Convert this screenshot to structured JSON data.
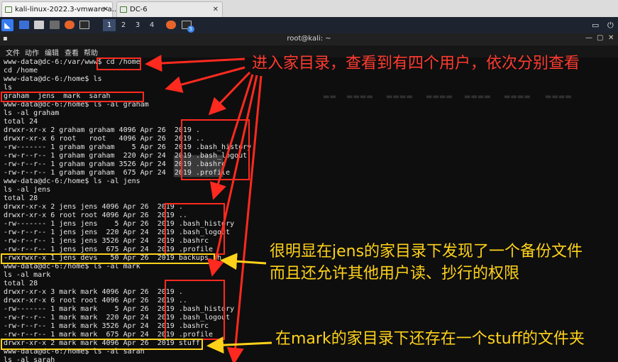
{
  "tabs": [
    {
      "label": "kali-linux-2022.3-vmware-a..."
    },
    {
      "label": "DC-6"
    }
  ],
  "taskbar": {
    "workspaces": [
      "1",
      "2",
      "3",
      "4"
    ],
    "badge": "5"
  },
  "window": {
    "title": "root@kali: ~"
  },
  "menu": [
    "文件",
    "动作",
    "编辑",
    "查看",
    "帮助"
  ],
  "terminal_lines": [
    "www-data@dc-6:/var/www$ cd /home",
    "cd /home",
    "www-data@dc-6:/home$ ls",
    "ls",
    "graham  jens  mark  sarah",
    "www-data@dc-6:/home$ ls -al graham",
    "ls -al graham",
    "total 24",
    "drwxr-xr-x 2 graham graham 4096 Apr 26  2019 .",
    "drwxr-xr-x 6 root   root   4096 Apr 26  2019 ..",
    "-rw------- 1 graham graham    5 Apr 26  2019 .bash_history",
    "-rw-r--r-- 1 graham graham  220 Apr 24  2019 .bash_logout",
    "-rw-r--r-- 1 graham graham 3526 Apr 24  2019 .bashrc",
    "-rw-r--r-- 1 graham graham  675 Apr 24  2019 .profile",
    "www-data@dc-6:/home$ ls -al jens",
    "ls -al jens",
    "total 28",
    "drwxr-xr-x 2 jens jens 4096 Apr 26  2019 .",
    "drwxr-xr-x 6 root root 4096 Apr 26  2019 ..",
    "-rw------- 1 jens jens    5 Apr 26  2019 .bash_history",
    "-rw-r--r-- 1 jens jens  220 Apr 24  2019 .bash_logout",
    "-rw-r--r-- 1 jens jens 3526 Apr 24  2019 .bashrc",
    "-rw-r--r-- 1 jens jens  675 Apr 24  2019 .profile",
    "-rwxrwxr-x 1 jens devs   50 Apr 26  2019 backups.sh",
    "www-data@dc-6:/home$ ls -al mark",
    "ls -al mark",
    "total 28",
    "drwxr-xr-x 3 mark mark 4096 Apr 26  2019 .",
    "drwxr-xr-x 6 root root 4096 Apr 26  2019 ..",
    "-rw------- 1 mark mark    5 Apr 26  2019 .bash_history",
    "-rw-r--r-- 1 mark mark  220 Apr 24  2019 .bash_logout",
    "-rw-r--r-- 1 mark mark 3526 Apr 24  2019 .bashrc",
    "-rw-r--r-- 1 mark mark  675 Apr 24  2019 .profile",
    "drwxr-xr-x 2 mark mark 4096 Apr 26  2019 stuff",
    "www-data@dc-6:/home$ ls -al sarah",
    "ls -al sarah"
  ],
  "annotations": {
    "home_users": "进入家目录，查看到有四个用户，依次分别查看",
    "jens_backup": "很明显在jens的家目录下发现了一个备份文件",
    "jens_perm": "而且还允许其他用户读、抄行的权限",
    "mark_stuff": "在mark的家目录下还存在一个stuff的文件夹"
  },
  "colors": {
    "annotation_red": "#ff3b30",
    "annotation_yellow": "#ffd21a",
    "terminal_bg": "#0e0e0e",
    "terminal_text": "#e6e6e6"
  }
}
